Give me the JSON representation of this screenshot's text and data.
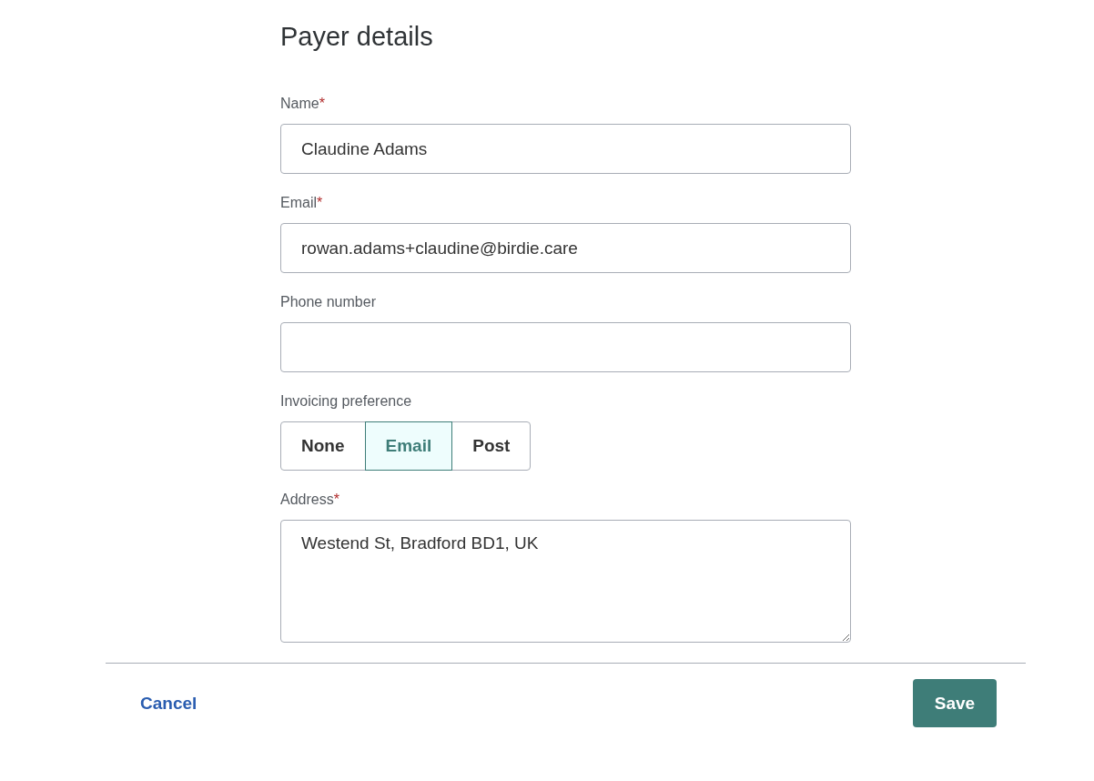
{
  "title": "Payer details",
  "fields": [
    {
      "kind": "input",
      "label": "Name",
      "required_mark": "*",
      "value": "Claudine Adams"
    },
    {
      "kind": "input",
      "label": "Email",
      "required_mark": "*",
      "value": "rowan.adams+claudine@birdie.care"
    },
    {
      "kind": "input",
      "label": "Phone number"
    },
    {
      "kind": "segmented",
      "label": "Invoicing preference",
      "options": [
        {
          "label": "None",
          "selected": false
        },
        {
          "label": "Email",
          "selected": true
        },
        {
          "label": "Post",
          "selected": false
        }
      ]
    },
    {
      "kind": "textarea",
      "label": "Address",
      "required_mark": "*",
      "value": "Westend St, Bradford BD1, UK"
    }
  ],
  "footer": {
    "cancel": "Cancel",
    "save": "Save"
  }
}
